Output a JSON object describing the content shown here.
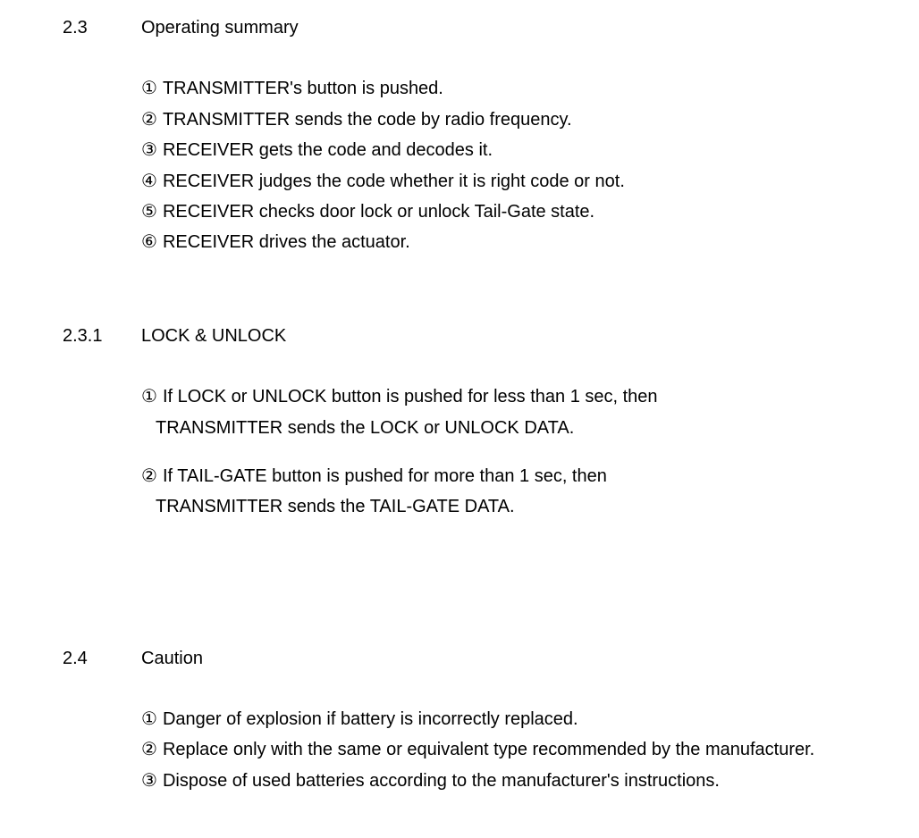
{
  "sections": {
    "s23": {
      "number": "2.3",
      "title": "Operating summary",
      "items": [
        {
          "marker": "①",
          "text": "TRANSMITTER's button is pushed."
        },
        {
          "marker": "②",
          "text": "TRANSMITTER sends the code by radio frequency."
        },
        {
          "marker": "③",
          "text": "RECEIVER gets the code and decodes it."
        },
        {
          "marker": "④",
          "text": "RECEIVER judges the code whether it is right code or not."
        },
        {
          "marker": "⑤",
          "text": "RECEIVER checks door lock or unlock Tail-Gate state."
        },
        {
          "marker": "⑥",
          "text": "RECEIVER drives the actuator."
        }
      ]
    },
    "s231": {
      "number": "2.3.1",
      "title": "LOCK & UNLOCK",
      "items": [
        {
          "marker": "①",
          "line1": "If LOCK or UNLOCK button is pushed for less than 1 sec, then",
          "line2": "TRANSMITTER sends the LOCK or UNLOCK DATA."
        },
        {
          "marker": "②",
          "line1": "If TAIL-GATE button is pushed for more than 1 sec, then",
          "line2": "TRANSMITTER sends the TAIL-GATE DATA."
        }
      ]
    },
    "s24": {
      "number": "2.4",
      "title": "Caution",
      "items": [
        {
          "marker": "①",
          "text": "Danger of explosion if battery is incorrectly replaced."
        },
        {
          "marker": "②",
          "text": "Replace only with the same or equivalent type recommended by the manufacturer."
        },
        {
          "marker": "③",
          "text": "Dispose of used batteries according to the manufacturer's instructions."
        }
      ]
    }
  }
}
